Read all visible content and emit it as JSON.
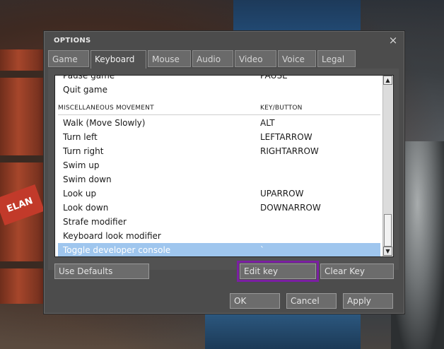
{
  "dialog": {
    "title": "OPTIONS",
    "close_glyph": "×"
  },
  "tabs": [
    {
      "label": "Game"
    },
    {
      "label": "Keyboard",
      "active": true
    },
    {
      "label": "Mouse"
    },
    {
      "label": "Audio"
    },
    {
      "label": "Video"
    },
    {
      "label": "Voice"
    },
    {
      "label": "Legal"
    }
  ],
  "keylist": {
    "rows": [
      {
        "name": "Pause game",
        "key": "PAUSE"
      },
      {
        "name": "Quit game",
        "key": ""
      }
    ],
    "section": {
      "name": "MISCELLANEOUS MOVEMENT",
      "key": "KEY/BUTTON"
    },
    "misc_rows": [
      {
        "name": "Walk (Move Slowly)",
        "key": "ALT"
      },
      {
        "name": "Turn left",
        "key": "LEFTARROW"
      },
      {
        "name": "Turn right",
        "key": "RIGHTARROW"
      },
      {
        "name": "Swim up",
        "key": ""
      },
      {
        "name": "Swim down",
        "key": ""
      },
      {
        "name": "Look up",
        "key": "UPARROW"
      },
      {
        "name": "Look down",
        "key": "DOWNARROW"
      },
      {
        "name": "Strafe modifier",
        "key": ""
      },
      {
        "name": "Keyboard look modifier",
        "key": ""
      },
      {
        "name": "Toggle developer console",
        "key": "`"
      }
    ],
    "scroll_up_glyph": "▲",
    "scroll_down_glyph": "▼"
  },
  "buttons": {
    "use_defaults": "Use Defaults",
    "edit_key": "Edit key",
    "clear_key": "Clear Key",
    "ok": "OK",
    "cancel": "Cancel",
    "apply": "Apply"
  },
  "background": {
    "barrel_logo": "ELAN"
  },
  "colors": {
    "selection": "#9fc6ee",
    "focus_outline": "#7b1fa2"
  }
}
